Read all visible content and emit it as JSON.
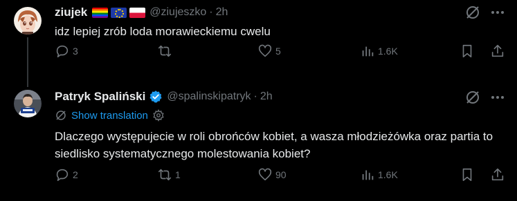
{
  "tweets": [
    {
      "author": {
        "name": "ziujek",
        "handle": "@ziujeszko",
        "flags": [
          "rainbow-flag",
          "eu-flag",
          "poland-flag"
        ]
      },
      "time": "2h",
      "text": "idz lepiej zrób loda morawieckiemu cwelu",
      "stats": {
        "replies": "3",
        "retweets": "",
        "likes": "5",
        "views": "1.6K"
      }
    },
    {
      "author": {
        "name": "Patryk Spaliński",
        "handle": "@spalinskipatryk",
        "verified": true
      },
      "time": "2h",
      "translate_label": "Show translation",
      "text": "Dlaczego występujecie w roli obrońców kobiet, a wasza młodzieżówka oraz partia to siedlisko systematycznego molestowania kobiet?",
      "stats": {
        "replies": "2",
        "retweets": "1",
        "likes": "90",
        "views": "1.6K"
      }
    }
  ],
  "separator": "·",
  "colors": {
    "background": "#000000",
    "text": "#e7e9ea",
    "muted": "#71767b",
    "accent": "#1d9bf0",
    "thread_line": "#333639"
  }
}
